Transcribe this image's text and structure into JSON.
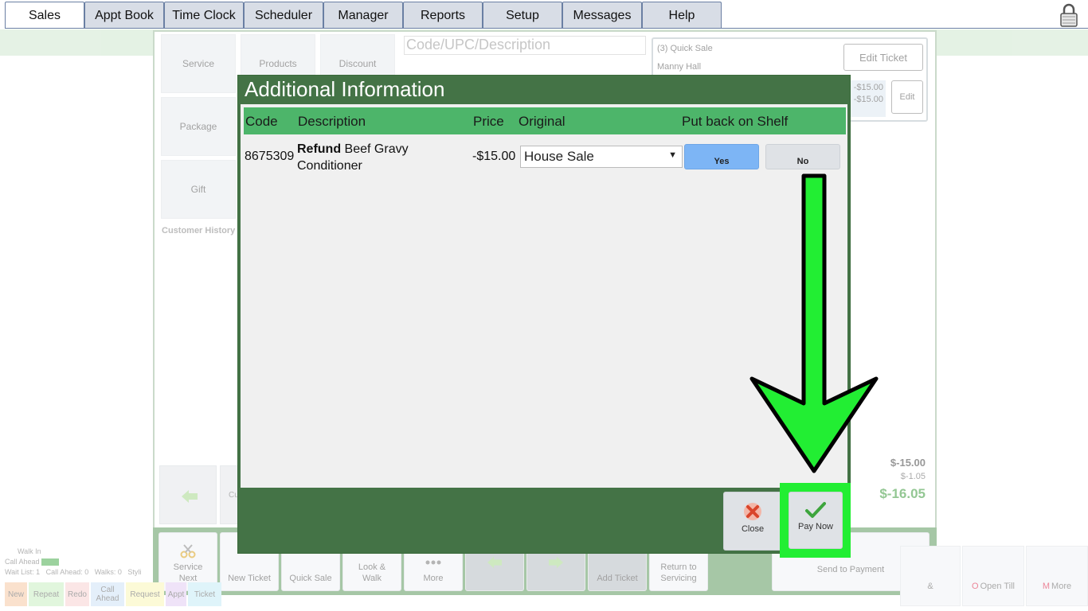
{
  "nav": {
    "tabs": [
      "Sales",
      "Appt Book",
      "Time Clock",
      "Scheduler",
      "Manager",
      "Reports",
      "Setup",
      "Messages",
      "Help"
    ],
    "active": "Sales",
    "lock_icon": "padlock-icon"
  },
  "background": {
    "tiles": [
      "Service",
      "Products",
      "Discount",
      "Package",
      "Gift"
    ],
    "customer_history": "Customer History",
    "code_placeholder": "Code/UPC/Description",
    "ticket": {
      "title": "(3) Quick Sale",
      "customer": "Manny Hall",
      "edit_ticket": "Edit Ticket",
      "edit": "Edit",
      "amount1": "-$15.00",
      "amount2": "-$15.00"
    },
    "totals": {
      "subtotal": "$-15.00",
      "tax": "$-1.05",
      "total": "$-16.05"
    },
    "bottom_buttons": [
      "Service Next",
      "New Ticket",
      "Quick Sale",
      "Look & Walk",
      "More",
      "Add Ticket",
      "Return to Servicing"
    ],
    "send_to_payment": "Send to Payment",
    "right_tiles": {
      "open_till": "Open Till",
      "open_till_key": "O",
      "more": "More",
      "more_key": "M",
      "amp": "&"
    },
    "walkin": {
      "title": "Walk In",
      "call_ahead": "Call Ahead",
      "stats": "Wait List: 1   Call Ahead: 0   Walks: 0   Styli"
    },
    "chips": [
      "New",
      "Repeat",
      "Redo",
      "Call Ahead",
      "Request",
      "Appt",
      "Ticket"
    ],
    "left_cut": "Cu"
  },
  "modal": {
    "title": "Additional Information",
    "columns": {
      "code": "Code",
      "description": "Description",
      "price": "Price",
      "original": "Original",
      "shelf": "Put back on Shelf"
    },
    "row": {
      "code": "8675309",
      "desc_bold": "Refund",
      "desc_rest": " Beef Gravy Conditioner",
      "price": "-$15.00",
      "original": "House Sale",
      "yes": "Yes",
      "no": "No"
    },
    "close": "Close",
    "pay_now": "Pay Now"
  }
}
